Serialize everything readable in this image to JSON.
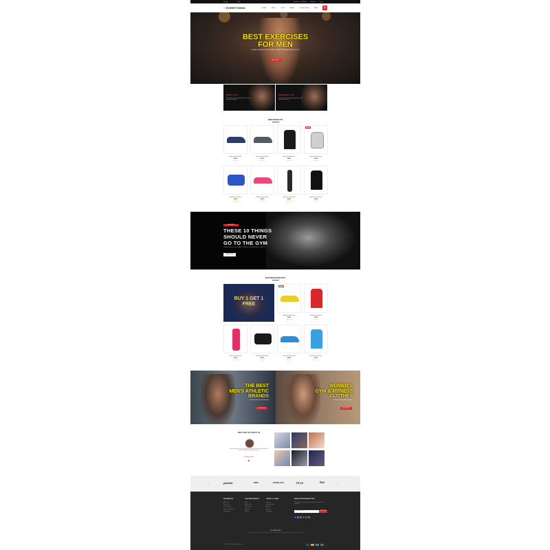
{
  "topbar": {
    "items": [
      "English",
      "USD",
      "My Account",
      "Wishlist",
      "Checkout",
      "Login"
    ]
  },
  "header": {
    "logo": "EVERYTHING",
    "nav": [
      "Home",
      "Shop",
      "Blog",
      "Pages",
      "Collections",
      "Sale"
    ],
    "cart_count": "0"
  },
  "hero": {
    "title_line1": "BEST EXERCISES",
    "title_line2": "FOR MEN",
    "subtitle": "LOREM IPSUM DOLOR SIT AMET CONSECTETUR ADIPISICING ELIT",
    "button": "SHOP NOW"
  },
  "promos": [
    {
      "title": "MEN'S GYM",
      "desc": "Start training with the beginning of classes and exercises at our gym"
    },
    {
      "title": "WOMEN'S GYM",
      "desc": "Start training with the beginning of classes and exercises at our gym"
    }
  ],
  "new_products": {
    "title": "NEW PRODUCTS",
    "items": [
      {
        "name": "Sample Product Name",
        "price": "$24.00",
        "stars": "★★★★★",
        "color": "#2b3e6b",
        "kind": "shoe",
        "sale": ""
      },
      {
        "name": "Sample Product Name",
        "price": "$36.00",
        "stars": "★★★★★",
        "color": "#555b66",
        "kind": "shoe",
        "sale": ""
      },
      {
        "name": "Sample Product Name",
        "price": "$48.00",
        "stars": "★★★★★",
        "color": "#1a1a1a",
        "kind": "shirt",
        "sale": ""
      },
      {
        "name": "Sample Product Name",
        "price": "$22.00",
        "stars": "★★★★★",
        "color": "#cfcfcf",
        "kind": "glove",
        "sale": "SALE"
      },
      {
        "name": "Sample Product Name",
        "price": "$55.00",
        "stars": "★★★★★",
        "color": "#2c57c9",
        "kind": "bag",
        "sale": ""
      },
      {
        "name": "Sample Product Name",
        "price": "$42.00",
        "stars": "★★★★★",
        "color": "#e84a7a",
        "kind": "shoe",
        "sale": ""
      },
      {
        "name": "Sample Product Name",
        "price": "$18.00",
        "stars": "★★★★★",
        "color": "#2a2a2a",
        "kind": "sleeve",
        "sale": ""
      },
      {
        "name": "Sample Product Name",
        "price": "$30.00",
        "stars": "★★★★★",
        "color": "#111111",
        "kind": "shirt",
        "sale": ""
      }
    ]
  },
  "banner": {
    "tag": "READ MORE",
    "line1": "THESE 10 THINGS",
    "line2": "SHOULD NEVER",
    "line3": "GO TO THE GYM",
    "subtitle": "LOREM IPSUM DOLOR SIT AMET CONSECTETUR ADIPISICING ELIT SED DO",
    "button": "READ MORE"
  },
  "featured": {
    "title": "FEATURED PRODUCTS",
    "promo_text_line1": "BUY 1 GET 1",
    "promo_text_line2": "FREE",
    "items": [
      {
        "name": "Sample Product Name",
        "price": "$64.00",
        "stars": "★★★★★",
        "color": "#e8d02a",
        "kind": "shoe",
        "sale": "SALE"
      },
      {
        "name": "Sample Product Name",
        "price": "$28.00",
        "stars": "★★★★★",
        "color": "#d8282c",
        "kind": "shirt",
        "sale": ""
      },
      {
        "name": "Sample Product Name",
        "price": "$15.00",
        "stars": "★★★★★",
        "color": "#e0306a",
        "kind": "bottle",
        "sale": ""
      },
      {
        "name": "Sample Product Name",
        "price": "$52.00",
        "stars": "★★★★★",
        "color": "#1a1a1a",
        "kind": "bag",
        "sale": ""
      },
      {
        "name": "Sample Product Name",
        "price": "$46.00",
        "stars": "★★★★★",
        "color": "#2a8fd8",
        "kind": "shoe",
        "sale": ""
      },
      {
        "name": "Sample Product Name",
        "price": "$26.00",
        "stars": "★★★★★",
        "color": "#3aa0e0",
        "kind": "shirt",
        "sale": ""
      }
    ]
  },
  "split_banners": [
    {
      "line1": "THE BEST",
      "line2": "MEN'S ATHLETIC",
      "line3": "BRANDS",
      "desc": "Lorem ipsum dolor sit amet consectetur",
      "button": "SHOP NOW"
    },
    {
      "line1": "WOMEN'S",
      "line2": "GYM & FITNESS",
      "line3": "CLOTHES",
      "desc": "Lorem ipsum dolor sit amet consectetur",
      "button": "SHOP NOW"
    }
  ],
  "testimonial": {
    "title": "WHAT THEY SAY ABOUT US",
    "quote": "Lorem ipsum dolor sit amet, consectetur adipisicing elit, sed do eiusmod tempor incididunt ut labore et dolore magna aliqua.",
    "author": "MICHAEL SMITH"
  },
  "brands": {
    "items": [
      "jabzilla",
      "MMA",
      "EVERLAST",
      "TITLE",
      "RDX"
    ]
  },
  "footer": {
    "columns": [
      {
        "title": "INFORMATION",
        "items": [
          "About Us",
          "Contact Us",
          "Privacy Policy",
          "Terms & Conditions",
          "Delivery Info"
        ]
      },
      {
        "title": "CUSTOMER SERVICE",
        "items": [
          "Help",
          "My Account",
          "Order History",
          "Wish List",
          "Returns"
        ]
      },
      {
        "title": "PRIVACY & TERMS",
        "items": [
          "Sitemap",
          "Gift Certificates",
          "Affiliate",
          "Specials",
          "Newsletter"
        ]
      },
      {
        "title": "NEWSLETTER SUBSCRIPTION",
        "items": [
          "Subscribe to our newsletter and get 10% off your first purchase"
        ]
      }
    ],
    "newsletter_placeholder": "Your email address",
    "subscribe_button": "SUBSCRIBE",
    "keywords_title": "TOP SEARCHES",
    "keywords_desc": "Fitness | Gym | Shoes | Gloves | Bags | Shirts | Bottles | Clothes | Brands | Accessories | Men | Women | Sale | New Arrivals",
    "copyright": "© 2017 Everything. All Rights Reserved."
  },
  "colors": {
    "accent": "#e1262d",
    "headline": "#f5e100",
    "footer_bg": "#262626"
  }
}
